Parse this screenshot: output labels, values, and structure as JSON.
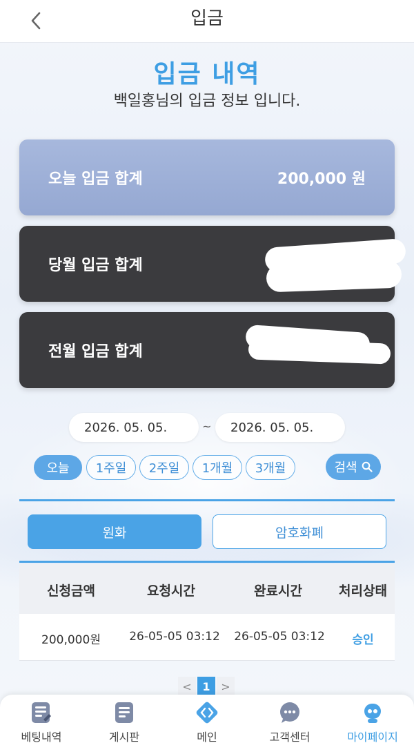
{
  "header": {
    "title": "입금"
  },
  "hero": {
    "title": "입금 내역",
    "subtitle": "백일홍님의 입금 정보 입니다."
  },
  "summary": {
    "today": {
      "label": "오늘 입금 합계",
      "value": "200,000 원"
    },
    "this_month": {
      "label": "당월 입금 합계",
      "value": ""
    },
    "last_month": {
      "label": "전월 입금 합계",
      "value": ""
    }
  },
  "date_range": {
    "start": "2026. 05. 05.",
    "separator": "~",
    "end": "2026. 05. 05."
  },
  "periods": [
    "오늘",
    "1주일",
    "2주일",
    "1개월",
    "3개월"
  ],
  "active_period": "오늘",
  "search_label": "검색",
  "currency_tabs": {
    "krw": "원화",
    "crypto": "암호화폐",
    "active": "원화"
  },
  "table": {
    "headers": [
      "신청금액",
      "요청시간",
      "완료시간",
      "처리상태"
    ],
    "rows": [
      {
        "amount": "200,000원",
        "requested": "26-05-05 03:12",
        "completed": "26-05-05 03:12",
        "status": "승인"
      }
    ]
  },
  "pagination": {
    "prev": "<",
    "current": "1",
    "next": ">"
  },
  "bottom_nav": {
    "items": [
      "베팅내역",
      "게시판",
      "메인",
      "고객센터",
      "마이페이지"
    ],
    "active": "마이페이지"
  },
  "colors": {
    "accent": "#3e9ee3",
    "dark_card": "#3b3b3e",
    "today_card": "#a0b2da"
  }
}
